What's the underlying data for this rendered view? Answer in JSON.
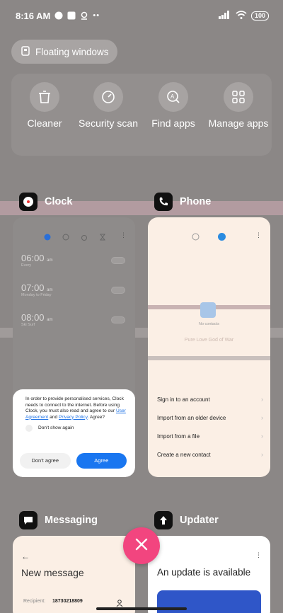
{
  "status_bar": {
    "time": "8:16 AM",
    "battery": "100"
  },
  "floating_windows_label": "Floating windows",
  "tools": [
    {
      "label": "Cleaner",
      "icon": "trash-icon"
    },
    {
      "label": "Security scan",
      "icon": "shield-check-icon"
    },
    {
      "label": "Find apps",
      "icon": "find-apps-icon"
    },
    {
      "label": "Manage apps",
      "icon": "grid-icon"
    }
  ],
  "cards": {
    "clock": {
      "title": "Clock",
      "alarms": [
        {
          "time": "06:00",
          "ampm": "am",
          "days": "Every"
        },
        {
          "time": "07:00",
          "ampm": "am",
          "days": "Monday to Friday"
        },
        {
          "time": "08:00",
          "ampm": "am",
          "days": "Ski Surf"
        }
      ],
      "dialog": {
        "text": "In order to provide personalised services, Clock needs to connect to the internet. Before using Clock, you must also read and agree to our",
        "link1": "User Agreement",
        "and": "and",
        "link2": "Privacy Policy",
        "agree_q": ". Agree?",
        "checkbox": "Don't show again",
        "disagree": "Don't agree",
        "agree": "Agree"
      }
    },
    "phone": {
      "title": "Phone",
      "no_contacts": "No contacts",
      "rows": [
        "Sign in to an account",
        "Import from an older device",
        "Import from a file",
        "Create a new contact"
      ]
    },
    "messaging": {
      "title": "Messaging",
      "heading": "New message",
      "recipient_label": "Recipient:",
      "recipient": "18730218809"
    },
    "updater": {
      "title": "Updater",
      "heading": "An update is available"
    }
  },
  "bg_text": "Pure Love God of War",
  "colors": {
    "close_fab": "#f2457f",
    "agree_button": "#1976f0"
  }
}
